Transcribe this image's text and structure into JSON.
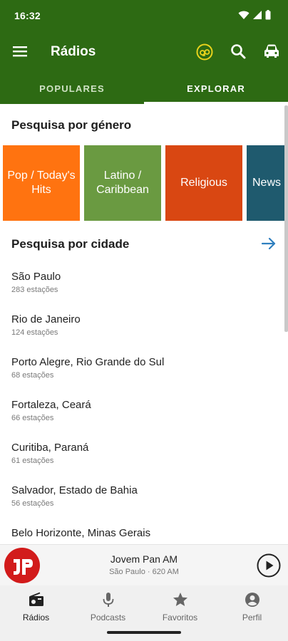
{
  "status_bar": {
    "time": "16:32"
  },
  "app_bar": {
    "title": "Rádios"
  },
  "tabs": [
    {
      "label": "POPULARES",
      "active": false
    },
    {
      "label": "EXPLORAR",
      "active": true
    }
  ],
  "genre_section": {
    "title": "Pesquisa por género",
    "genres": [
      {
        "label": "Pop / Today's Hits",
        "color": "#ff7310"
      },
      {
        "label": "Latino / Caribbean",
        "color": "#6a9a41"
      },
      {
        "label": "Religious",
        "color": "#d94712"
      },
      {
        "label": "News",
        "color": "#1f5a6e"
      }
    ]
  },
  "city_section": {
    "title": "Pesquisa por cidade",
    "cities": [
      {
        "name": "São Paulo",
        "count": "283 estações"
      },
      {
        "name": "Rio de Janeiro",
        "count": "124 estações"
      },
      {
        "name": "Porto Alegre, Rio Grande do Sul",
        "count": "68 estações"
      },
      {
        "name": "Fortaleza, Ceará",
        "count": "66 estações"
      },
      {
        "name": "Curitiba, Paraná",
        "count": "61 estações"
      },
      {
        "name": "Salvador, Estado de Bahia",
        "count": "56 estações"
      },
      {
        "name": "Belo Horizonte, Minas Gerais",
        "count": ""
      }
    ]
  },
  "player": {
    "station": "Jovem Pan AM",
    "subtitle": "São Paulo · 620 AM",
    "logo_color": "#d21b1b"
  },
  "bottom_nav": [
    {
      "label": "Rádios",
      "icon": "radio-icon",
      "active": true
    },
    {
      "label": "Podcasts",
      "icon": "microphone-icon",
      "active": false
    },
    {
      "label": "Favoritos",
      "icon": "star-icon",
      "active": false
    },
    {
      "label": "Perfil",
      "icon": "account-icon",
      "active": false
    }
  ],
  "colors": {
    "brand_green": "#2d6a13",
    "accent_blue": "#2f7fbf",
    "go_yellow": "#e8d21c"
  }
}
